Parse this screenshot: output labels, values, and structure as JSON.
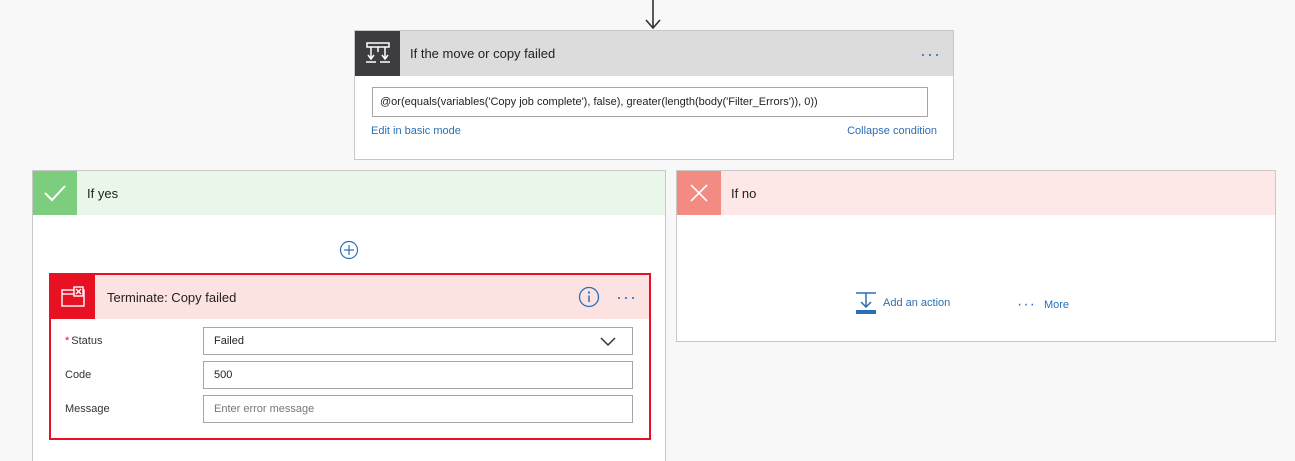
{
  "condition": {
    "title": "If the move or copy failed",
    "menu": "···",
    "expression": "@or(equals(variables('Copy job complete'), false), greater(length(body('Filter_Errors')), 0))",
    "edit_basic_label": "Edit in basic mode",
    "collapse_label": "Collapse condition"
  },
  "yes_branch": {
    "title": "If yes",
    "terminate": {
      "title": "Terminate: Copy failed",
      "menu": "···",
      "fields": {
        "status": {
          "label": "Status",
          "required_mark": "*",
          "value": "Failed"
        },
        "code": {
          "label": "Code",
          "value": "500"
        },
        "message": {
          "label": "Message",
          "placeholder": "Enter error message"
        }
      }
    }
  },
  "no_branch": {
    "title": "If no",
    "add_action_label": "Add an action",
    "more_label": "More",
    "more_dots": "···"
  },
  "colors": {
    "accent": "#2a7ad5",
    "yes_header": "#e8f7e9",
    "yes_icon": "#7ccd7e",
    "no_header": "#fde7e7",
    "no_icon": "#f28b82",
    "terminate_red": "#e81123",
    "condition_icon": "#3c3c41"
  },
  "icons": {
    "flow_arrow": "arrow-down-icon",
    "condition": "condition-icon",
    "yes": "check-icon",
    "no": "x-icon",
    "terminate": "terminate-icon",
    "info": "info-icon",
    "add": "plus-circle-icon",
    "add_action": "add-action-icon",
    "dropdown": "chevron-down-icon"
  }
}
